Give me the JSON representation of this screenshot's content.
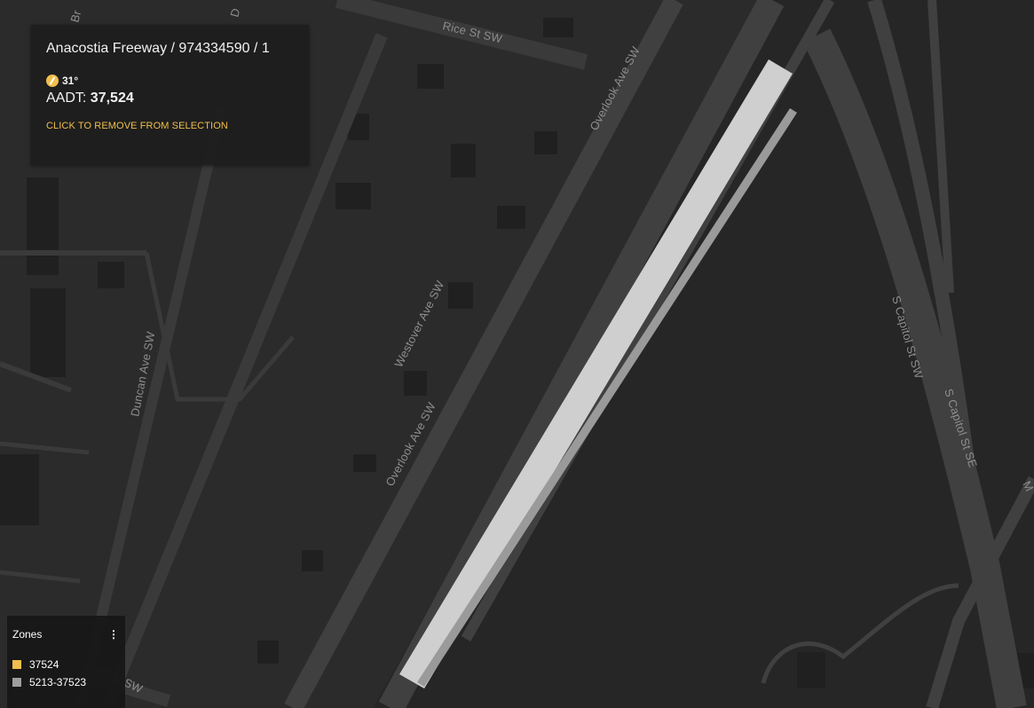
{
  "map": {
    "road_labels": {
      "rice": "Rice St SW",
      "overlook_top": "Overlook Ave SW",
      "overlook_bottom": "Overlook Ave SW",
      "westover": "Westover Ave SW",
      "duncan": "Duncan Ave SW",
      "capitol_sw": "S Capitol St SW",
      "capitol_se": "S Capitol St SE",
      "bell": "ell St SW",
      "br_fragment": "Br",
      "d_fragment": "D",
      "m_fragment": "M"
    }
  },
  "info_panel": {
    "title": "Anacostia Freeway / 974334590 / 1",
    "bearing": "31°",
    "aadt_label": "AADT: ",
    "aadt_value": "37,524",
    "remove_link": "CLICK TO REMOVE FROM SELECTION"
  },
  "zones": {
    "title": "Zones",
    "menu_icon": "⋮",
    "items": [
      {
        "label": "37524",
        "color": "#f0bf4c"
      },
      {
        "label": "5213-37523",
        "color": "#9e9e9e"
      }
    ]
  },
  "colors": {
    "background": "#262626",
    "road": "#3c3c3c",
    "highlight_segment": "#d0d0d0",
    "accent": "#f0bf4c"
  }
}
